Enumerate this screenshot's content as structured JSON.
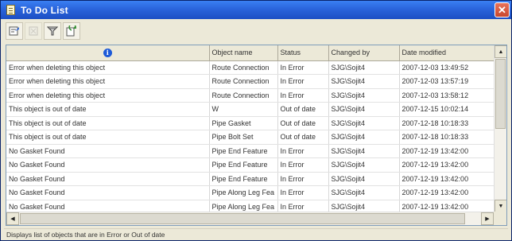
{
  "window": {
    "title": "To Do List",
    "close_glyph": "✕"
  },
  "toolbar": {
    "buttons": [
      {
        "icon": "properties-icon",
        "enabled": true
      },
      {
        "icon": "delete-icon",
        "enabled": false
      },
      {
        "icon": "filter-icon",
        "enabled": true
      },
      {
        "icon": "refresh-icon",
        "enabled": true
      }
    ]
  },
  "grid": {
    "columns": {
      "message_icon": "info-icon",
      "object_name": "Object name",
      "status": "Status",
      "changed_by": "Changed by",
      "date_modified": "Date modified"
    },
    "rows": [
      {
        "message": "Error when deleting this object",
        "object_name": "Route Connection",
        "status": "In Error",
        "changed_by": "SJG\\Sojit4",
        "date_modified": "2007-12-03 13:49:52"
      },
      {
        "message": "Error when deleting this object",
        "object_name": "Route Connection",
        "status": "In Error",
        "changed_by": "SJG\\Sojit4",
        "date_modified": "2007-12-03 13:57:19"
      },
      {
        "message": "Error when deleting this object",
        "object_name": "Route Connection",
        "status": "In Error",
        "changed_by": "SJG\\Sojit4",
        "date_modified": "2007-12-03 13:58:12"
      },
      {
        "message": "This object is out of date",
        "object_name": "W",
        "status": "Out of date",
        "changed_by": "SJG\\Sojit4",
        "date_modified": "2007-12-15 10:02:14"
      },
      {
        "message": "This object is out of date",
        "object_name": "Pipe Gasket",
        "status": "Out of date",
        "changed_by": "SJG\\Sojit4",
        "date_modified": "2007-12-18 10:18:33"
      },
      {
        "message": "This object is out of date",
        "object_name": "Pipe Bolt Set",
        "status": "Out of date",
        "changed_by": "SJG\\Sojit4",
        "date_modified": "2007-12-18 10:18:33"
      },
      {
        "message": "No Gasket Found",
        "object_name": "Pipe End Feature",
        "status": "In Error",
        "changed_by": "SJG\\Sojit4",
        "date_modified": "2007-12-19 13:42:00"
      },
      {
        "message": "No Gasket Found",
        "object_name": "Pipe End Feature",
        "status": "In Error",
        "changed_by": "SJG\\Sojit4",
        "date_modified": "2007-12-19 13:42:00"
      },
      {
        "message": "No Gasket Found",
        "object_name": "Pipe End Feature",
        "status": "In Error",
        "changed_by": "SJG\\Sojit4",
        "date_modified": "2007-12-19 13:42:00"
      },
      {
        "message": "No Gasket Found",
        "object_name": "Pipe Along Leg Fea",
        "status": "In Error",
        "changed_by": "SJG\\Sojit4",
        "date_modified": "2007-12-19 13:42:00"
      },
      {
        "message": "No Gasket Found",
        "object_name": "Pipe Along Leg Fea",
        "status": "In Error",
        "changed_by": "SJG\\Sojit4",
        "date_modified": "2007-12-19 13:42:00"
      }
    ]
  },
  "statusbar": {
    "text": "Displays list of objects that are in Error or Out of date"
  }
}
